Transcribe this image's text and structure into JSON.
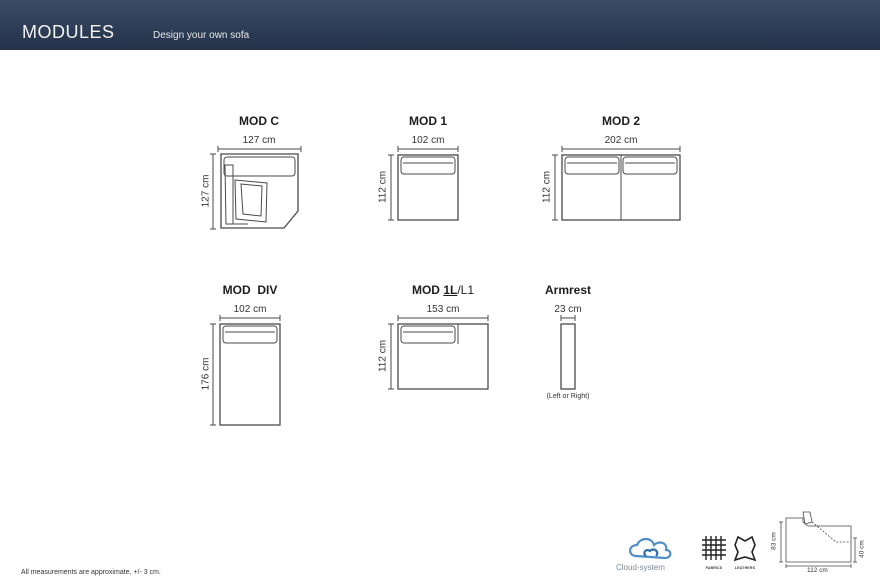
{
  "header": {
    "title": "MODULES",
    "subtitle": "Design your own sofa"
  },
  "modules": {
    "mod_c": {
      "name": "MOD C",
      "width": "127 cm",
      "depth": "127 cm"
    },
    "mod_1": {
      "name": "MOD 1",
      "width": "102 cm",
      "depth": "112 cm"
    },
    "mod_2": {
      "name": "MOD 2",
      "width": "202 cm",
      "depth": "112 cm"
    },
    "mod_div": {
      "name": "MOD  DIV",
      "width": "102 cm",
      "depth": "176 cm"
    },
    "mod_1l": {
      "name_prefix": "MOD ",
      "name_underlined": "1L",
      "name_suffix": "/L1",
      "width": "153 cm",
      "depth": "112 cm"
    },
    "armrest": {
      "name": "Armrest",
      "width": "23 cm",
      "note": "(Left or Right)"
    }
  },
  "side_profile": {
    "height": "83 cm",
    "seat_height": "40 cm",
    "depth": "112 cm"
  },
  "badges": {
    "brand": "Cloud-system",
    "fabrics": "FABRICS",
    "leathers": "LEATHERS"
  },
  "footer": {
    "note": "All measurements are approximate, +/- 3 cm."
  }
}
